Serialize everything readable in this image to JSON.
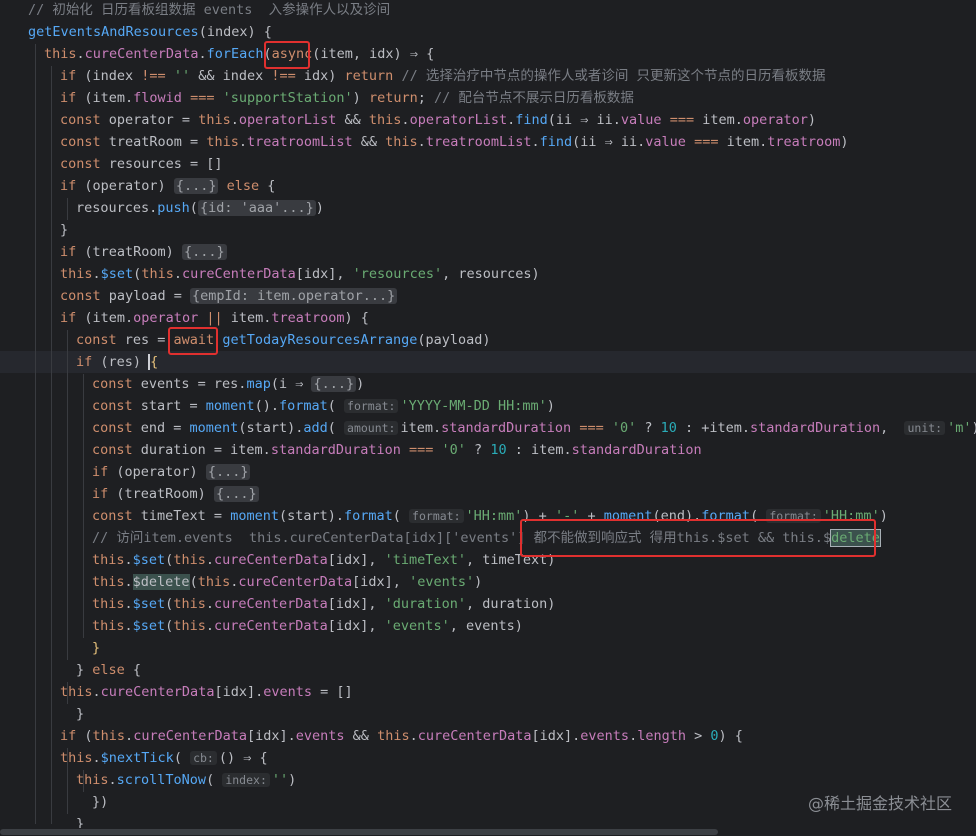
{
  "watermark": "@稀土掘金技术社区",
  "lines": [
    [
      {
        "t": "com",
        "s": "// 初始化 日历看板组数据 events  入参操作人以及诊间"
      }
    ],
    [
      {
        "t": "fn",
        "s": "getEventsAndResources"
      },
      {
        "t": "op",
        "s": "(index) {"
      }
    ],
    [
      {
        "t": "kw",
        "s": "this"
      },
      {
        "t": "op",
        "s": "."
      },
      {
        "t": "prop",
        "s": "cureCenterData"
      },
      {
        "t": "op",
        "s": "."
      },
      {
        "t": "fn",
        "s": "forEach"
      },
      {
        "t": "op",
        "s": "("
      },
      {
        "t": "kw",
        "s": "async"
      },
      {
        "t": "op",
        "s": "(item, idx) ⇒ {"
      }
    ],
    [
      {
        "t": "kw",
        "s": "if"
      },
      {
        "t": "op",
        "s": " (index "
      },
      {
        "t": "kw",
        "s": "!=="
      },
      {
        "t": "op",
        "s": " "
      },
      {
        "t": "str",
        "s": "''"
      },
      {
        "t": "op",
        "s": " && index "
      },
      {
        "t": "kw",
        "s": "!=="
      },
      {
        "t": "op",
        "s": " idx) "
      },
      {
        "t": "kw",
        "s": "return"
      },
      {
        "t": "op",
        "s": " "
      },
      {
        "t": "com",
        "s": "// 选择治疗中节点的操作人或者诊间 只更新这个节点的日历看板数据"
      }
    ],
    [
      {
        "t": "kw",
        "s": "if"
      },
      {
        "t": "op",
        "s": " (item."
      },
      {
        "t": "prop",
        "s": "flowid"
      },
      {
        "t": "op",
        "s": " "
      },
      {
        "t": "kw",
        "s": "==="
      },
      {
        "t": "op",
        "s": " "
      },
      {
        "t": "str",
        "s": "'supportStation'"
      },
      {
        "t": "op",
        "s": ") "
      },
      {
        "t": "kw",
        "s": "return"
      },
      {
        "t": "op",
        "s": "; "
      },
      {
        "t": "com",
        "s": "// 配台节点不展示日历看板数据"
      }
    ],
    [
      {
        "t": "kw",
        "s": "const"
      },
      {
        "t": "op",
        "s": " operator = "
      },
      {
        "t": "kw",
        "s": "this"
      },
      {
        "t": "op",
        "s": "."
      },
      {
        "t": "prop",
        "s": "operatorList"
      },
      {
        "t": "op",
        "s": " && "
      },
      {
        "t": "kw",
        "s": "this"
      },
      {
        "t": "op",
        "s": "."
      },
      {
        "t": "prop",
        "s": "operatorList"
      },
      {
        "t": "op",
        "s": "."
      },
      {
        "t": "fn",
        "s": "find"
      },
      {
        "t": "op",
        "s": "(ii ⇒ ii."
      },
      {
        "t": "prop",
        "s": "value"
      },
      {
        "t": "op",
        "s": " "
      },
      {
        "t": "kw",
        "s": "==="
      },
      {
        "t": "op",
        "s": " item."
      },
      {
        "t": "prop",
        "s": "operator"
      },
      {
        "t": "op",
        "s": ")"
      }
    ],
    [
      {
        "t": "kw",
        "s": "const"
      },
      {
        "t": "op",
        "s": " treatRoom = "
      },
      {
        "t": "kw",
        "s": "this"
      },
      {
        "t": "op",
        "s": "."
      },
      {
        "t": "prop",
        "s": "treatroomList"
      },
      {
        "t": "op",
        "s": " && "
      },
      {
        "t": "kw",
        "s": "this"
      },
      {
        "t": "op",
        "s": "."
      },
      {
        "t": "prop",
        "s": "treatroomList"
      },
      {
        "t": "op",
        "s": "."
      },
      {
        "t": "fn",
        "s": "find"
      },
      {
        "t": "op",
        "s": "(ii ⇒ ii."
      },
      {
        "t": "prop",
        "s": "value"
      },
      {
        "t": "op",
        "s": " "
      },
      {
        "t": "kw",
        "s": "==="
      },
      {
        "t": "op",
        "s": " item."
      },
      {
        "t": "prop",
        "s": "treatroom"
      },
      {
        "t": "op",
        "s": ")"
      }
    ],
    [
      {
        "t": "kw",
        "s": "const"
      },
      {
        "t": "op",
        "s": " resources = []"
      }
    ],
    [
      {
        "t": "kw",
        "s": "if"
      },
      {
        "t": "op",
        "s": " (operator) "
      },
      {
        "t": "fold",
        "s": "{...}"
      },
      {
        "t": "op",
        "s": " "
      },
      {
        "t": "kw",
        "s": "else"
      },
      {
        "t": "op",
        "s": " {"
      }
    ],
    [
      {
        "t": "op",
        "s": "resources."
      },
      {
        "t": "fn",
        "s": "push"
      },
      {
        "t": "op",
        "s": "("
      },
      {
        "t": "fold",
        "s": "{id: 'aaa'...}"
      },
      {
        "t": "op",
        "s": ")"
      }
    ],
    [
      {
        "t": "op",
        "s": "}"
      }
    ],
    [
      {
        "t": "kw",
        "s": "if"
      },
      {
        "t": "op",
        "s": " (treatRoom) "
      },
      {
        "t": "fold",
        "s": "{...}"
      }
    ],
    [
      {
        "t": "kw",
        "s": "this"
      },
      {
        "t": "op",
        "s": "."
      },
      {
        "t": "fn",
        "s": "$set"
      },
      {
        "t": "op",
        "s": "("
      },
      {
        "t": "kw",
        "s": "this"
      },
      {
        "t": "op",
        "s": "."
      },
      {
        "t": "prop",
        "s": "cureCenterData"
      },
      {
        "t": "op",
        "s": "[idx], "
      },
      {
        "t": "str",
        "s": "'resources'"
      },
      {
        "t": "op",
        "s": ", resources)"
      }
    ],
    [
      {
        "t": "kw",
        "s": "const"
      },
      {
        "t": "op",
        "s": " payload = "
      },
      {
        "t": "fold",
        "s": "{empId: item.operator...}"
      }
    ],
    [
      {
        "t": "kw",
        "s": "if"
      },
      {
        "t": "op",
        "s": " (item."
      },
      {
        "t": "prop",
        "s": "operator"
      },
      {
        "t": "op",
        "s": " "
      },
      {
        "t": "kw",
        "s": "||"
      },
      {
        "t": "op",
        "s": " item."
      },
      {
        "t": "prop",
        "s": "treatroom"
      },
      {
        "t": "op",
        "s": ") {"
      }
    ],
    [
      {
        "t": "kw",
        "s": "const"
      },
      {
        "t": "op",
        "s": " res = "
      },
      {
        "t": "kw",
        "s": "await"
      },
      {
        "t": "op",
        "s": " "
      },
      {
        "t": "fn",
        "s": "getTodayResourcesArrange"
      },
      {
        "t": "op",
        "s": "(payload)"
      }
    ],
    [
      {
        "t": "kw",
        "s": "if"
      },
      {
        "t": "op",
        "s": " (res) "
      },
      {
        "t": "cursor",
        "s": ""
      },
      {
        "t": "brace",
        "s": "{"
      }
    ],
    [
      {
        "t": "kw",
        "s": "const"
      },
      {
        "t": "op",
        "s": " events = res."
      },
      {
        "t": "fn",
        "s": "map"
      },
      {
        "t": "op",
        "s": "(i ⇒ "
      },
      {
        "t": "fold",
        "s": "{...}"
      },
      {
        "t": "op",
        "s": ")"
      }
    ],
    [
      {
        "t": "kw",
        "s": "const"
      },
      {
        "t": "op",
        "s": " start = "
      },
      {
        "t": "fn",
        "s": "moment"
      },
      {
        "t": "op",
        "s": "()."
      },
      {
        "t": "fn",
        "s": "format"
      },
      {
        "t": "op",
        "s": "( "
      },
      {
        "t": "hint",
        "s": "format:"
      },
      {
        "t": "str",
        "s": "'YYYY-MM-DD HH:mm'"
      },
      {
        "t": "op",
        "s": ")"
      }
    ],
    [
      {
        "t": "kw",
        "s": "const"
      },
      {
        "t": "op",
        "s": " end = "
      },
      {
        "t": "fn",
        "s": "moment"
      },
      {
        "t": "op",
        "s": "(start)."
      },
      {
        "t": "fn",
        "s": "add"
      },
      {
        "t": "op",
        "s": "( "
      },
      {
        "t": "hint",
        "s": "amount:"
      },
      {
        "t": "op",
        "s": "item."
      },
      {
        "t": "prop",
        "s": "standardDuration"
      },
      {
        "t": "op",
        "s": " "
      },
      {
        "t": "kw",
        "s": "==="
      },
      {
        "t": "op",
        "s": " "
      },
      {
        "t": "str",
        "s": "'0'"
      },
      {
        "t": "op",
        "s": " ? "
      },
      {
        "t": "num",
        "s": "10"
      },
      {
        "t": "op",
        "s": " : +item."
      },
      {
        "t": "prop",
        "s": "standardDuration"
      },
      {
        "t": "op",
        "s": ",  "
      },
      {
        "t": "hint",
        "s": "unit:"
      },
      {
        "t": "str",
        "s": "'m'"
      },
      {
        "t": "op",
        "s": ")"
      }
    ],
    [
      {
        "t": "kw",
        "s": "const"
      },
      {
        "t": "op",
        "s": " duration = item."
      },
      {
        "t": "prop",
        "s": "standardDuration"
      },
      {
        "t": "op",
        "s": " "
      },
      {
        "t": "kw",
        "s": "==="
      },
      {
        "t": "op",
        "s": " "
      },
      {
        "t": "str",
        "s": "'0'"
      },
      {
        "t": "op",
        "s": " ? "
      },
      {
        "t": "num",
        "s": "10"
      },
      {
        "t": "op",
        "s": " : item."
      },
      {
        "t": "prop",
        "s": "standardDuration"
      }
    ],
    [
      {
        "t": "kw",
        "s": "if"
      },
      {
        "t": "op",
        "s": " (operator) "
      },
      {
        "t": "fold",
        "s": "{...}"
      }
    ],
    [
      {
        "t": "kw",
        "s": "if"
      },
      {
        "t": "op",
        "s": " (treatRoom) "
      },
      {
        "t": "fold",
        "s": "{...}"
      }
    ],
    [
      {
        "t": "kw",
        "s": "const"
      },
      {
        "t": "op",
        "s": " timeText = "
      },
      {
        "t": "fn",
        "s": "moment"
      },
      {
        "t": "op",
        "s": "(start)."
      },
      {
        "t": "fn",
        "s": "format"
      },
      {
        "t": "op",
        "s": "( "
      },
      {
        "t": "hint",
        "s": "format:"
      },
      {
        "t": "str",
        "s": "'HH:mm'"
      },
      {
        "t": "op",
        "s": ") + "
      },
      {
        "t": "str",
        "s": "'-'"
      },
      {
        "t": "op",
        "s": " + "
      },
      {
        "t": "fn",
        "s": "moment"
      },
      {
        "t": "op",
        "s": "(end)."
      },
      {
        "t": "fn",
        "s": "format"
      },
      {
        "t": "op",
        "s": "( "
      },
      {
        "t": "hint",
        "s": "format:"
      },
      {
        "t": "str",
        "s": "'HH:mm'"
      },
      {
        "t": "op",
        "s": ")"
      }
    ],
    [
      {
        "t": "com",
        "s": "// 访问item.events  this.cureCenterData[idx]['events'] 都不能做到响应式 得用this.$set && this.$"
      },
      {
        "t": "hlbox",
        "s": "delete"
      }
    ],
    [
      {
        "t": "kw",
        "s": "this"
      },
      {
        "t": "op",
        "s": "."
      },
      {
        "t": "fn",
        "s": "$set"
      },
      {
        "t": "op",
        "s": "("
      },
      {
        "t": "kw",
        "s": "this"
      },
      {
        "t": "op",
        "s": "."
      },
      {
        "t": "prop",
        "s": "cureCenterData"
      },
      {
        "t": "op",
        "s": "[idx], "
      },
      {
        "t": "str",
        "s": "'timeText'"
      },
      {
        "t": "op",
        "s": ", timeText)"
      }
    ],
    [
      {
        "t": "kw",
        "s": "this"
      },
      {
        "t": "op",
        "s": "."
      },
      {
        "t": "hl",
        "s": "$delete"
      },
      {
        "t": "op",
        "s": "("
      },
      {
        "t": "kw",
        "s": "this"
      },
      {
        "t": "op",
        "s": "."
      },
      {
        "t": "prop",
        "s": "cureCenterData"
      },
      {
        "t": "op",
        "s": "[idx], "
      },
      {
        "t": "str",
        "s": "'events'"
      },
      {
        "t": "op",
        "s": ")"
      }
    ],
    [
      {
        "t": "kw",
        "s": "this"
      },
      {
        "t": "op",
        "s": "."
      },
      {
        "t": "fn",
        "s": "$set"
      },
      {
        "t": "op",
        "s": "("
      },
      {
        "t": "kw",
        "s": "this"
      },
      {
        "t": "op",
        "s": "."
      },
      {
        "t": "prop",
        "s": "cureCenterData"
      },
      {
        "t": "op",
        "s": "[idx], "
      },
      {
        "t": "str",
        "s": "'duration'"
      },
      {
        "t": "op",
        "s": ", duration)"
      }
    ],
    [
      {
        "t": "kw",
        "s": "this"
      },
      {
        "t": "op",
        "s": "."
      },
      {
        "t": "fn",
        "s": "$set"
      },
      {
        "t": "op",
        "s": "("
      },
      {
        "t": "kw",
        "s": "this"
      },
      {
        "t": "op",
        "s": "."
      },
      {
        "t": "prop",
        "s": "cureCenterData"
      },
      {
        "t": "op",
        "s": "[idx], "
      },
      {
        "t": "str",
        "s": "'events'"
      },
      {
        "t": "op",
        "s": ", events)"
      }
    ],
    [
      {
        "t": "brace",
        "s": "}"
      }
    ],
    [
      {
        "t": "op",
        "s": "} "
      },
      {
        "t": "kw",
        "s": "else"
      },
      {
        "t": "op",
        "s": " {"
      }
    ],
    [
      {
        "t": "kw",
        "s": "this"
      },
      {
        "t": "op",
        "s": "."
      },
      {
        "t": "prop",
        "s": "cureCenterData"
      },
      {
        "t": "op",
        "s": "[idx]."
      },
      {
        "t": "prop",
        "s": "events"
      },
      {
        "t": "op",
        "s": " = []"
      }
    ],
    [
      {
        "t": "op",
        "s": "}"
      }
    ],
    [
      {
        "t": "kw",
        "s": "if"
      },
      {
        "t": "op",
        "s": " ("
      },
      {
        "t": "kw",
        "s": "this"
      },
      {
        "t": "op",
        "s": "."
      },
      {
        "t": "prop",
        "s": "cureCenterData"
      },
      {
        "t": "op",
        "s": "[idx]."
      },
      {
        "t": "prop",
        "s": "events"
      },
      {
        "t": "op",
        "s": " && "
      },
      {
        "t": "kw",
        "s": "this"
      },
      {
        "t": "op",
        "s": "."
      },
      {
        "t": "prop",
        "s": "cureCenterData"
      },
      {
        "t": "op",
        "s": "[idx]."
      },
      {
        "t": "prop",
        "s": "events"
      },
      {
        "t": "op",
        "s": "."
      },
      {
        "t": "prop",
        "s": "length"
      },
      {
        "t": "op",
        "s": " > "
      },
      {
        "t": "num",
        "s": "0"
      },
      {
        "t": "op",
        "s": ") {"
      }
    ],
    [
      {
        "t": "kw",
        "s": "this"
      },
      {
        "t": "op",
        "s": "."
      },
      {
        "t": "fn",
        "s": "$nextTick"
      },
      {
        "t": "op",
        "s": "( "
      },
      {
        "t": "hint",
        "s": "cb:"
      },
      {
        "t": "op",
        "s": "() ⇒ {"
      }
    ],
    [
      {
        "t": "kw",
        "s": "this"
      },
      {
        "t": "op",
        "s": "."
      },
      {
        "t": "fn",
        "s": "scrollToNow"
      },
      {
        "t": "op",
        "s": "( "
      },
      {
        "t": "hint",
        "s": "index:"
      },
      {
        "t": "str",
        "s": "''"
      },
      {
        "t": "op",
        "s": ")"
      }
    ],
    [
      {
        "t": "op",
        "s": "})"
      }
    ],
    [
      {
        "t": "op",
        "s": "}"
      }
    ]
  ]
}
